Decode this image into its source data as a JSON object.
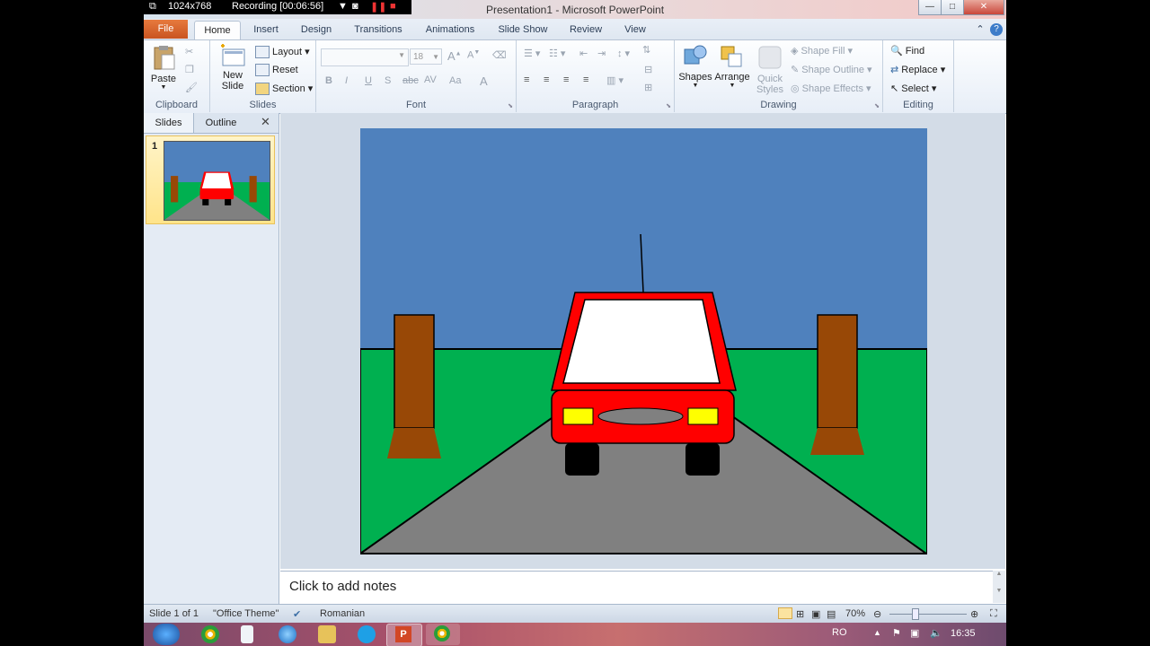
{
  "recorder": {
    "resolution": "1024x768",
    "status": "Recording [00:06:56]"
  },
  "window": {
    "title": "Presentation1 - Microsoft PowerPoint"
  },
  "tabs": {
    "file": "File",
    "items": [
      "Home",
      "Insert",
      "Design",
      "Transitions",
      "Animations",
      "Slide Show",
      "Review",
      "View"
    ]
  },
  "ribbon": {
    "clipboard": {
      "label": "Clipboard",
      "paste": "Paste"
    },
    "slides": {
      "label": "Slides",
      "new_slide": "New Slide",
      "layout": "Layout",
      "reset": "Reset",
      "section": "Section"
    },
    "font": {
      "label": "Font",
      "size": "18",
      "bold": "B",
      "italic": "I",
      "underline": "U",
      "strike": "S",
      "abc": "abc",
      "aa": "Aa",
      "a": "A"
    },
    "paragraph": {
      "label": "Paragraph"
    },
    "drawing": {
      "label": "Drawing",
      "shapes": "Shapes",
      "arrange": "Arrange",
      "quick_styles": "Quick Styles",
      "shape_fill": "Shape Fill",
      "shape_outline": "Shape Outline",
      "shape_effects": "Shape Effects"
    },
    "editing": {
      "label": "Editing",
      "find": "Find",
      "replace": "Replace",
      "select": "Select"
    }
  },
  "left_pane": {
    "tab_slides": "Slides",
    "tab_outline": "Outline",
    "slide_number": "1"
  },
  "notes": {
    "placeholder": "Click to add notes"
  },
  "status": {
    "slide": "Slide 1 of 1",
    "theme": "\"Office Theme\"",
    "language": "Romanian",
    "zoom": "70%"
  },
  "taskbar": {
    "lang": "RO",
    "time": "16:35"
  },
  "colors": {
    "sky": "#4f81bd",
    "grass": "#00b050",
    "road": "#808080",
    "car": "#ff0000",
    "trunk": "#984806",
    "lights": "#ffff00",
    "file_tab": "#d9622b"
  }
}
